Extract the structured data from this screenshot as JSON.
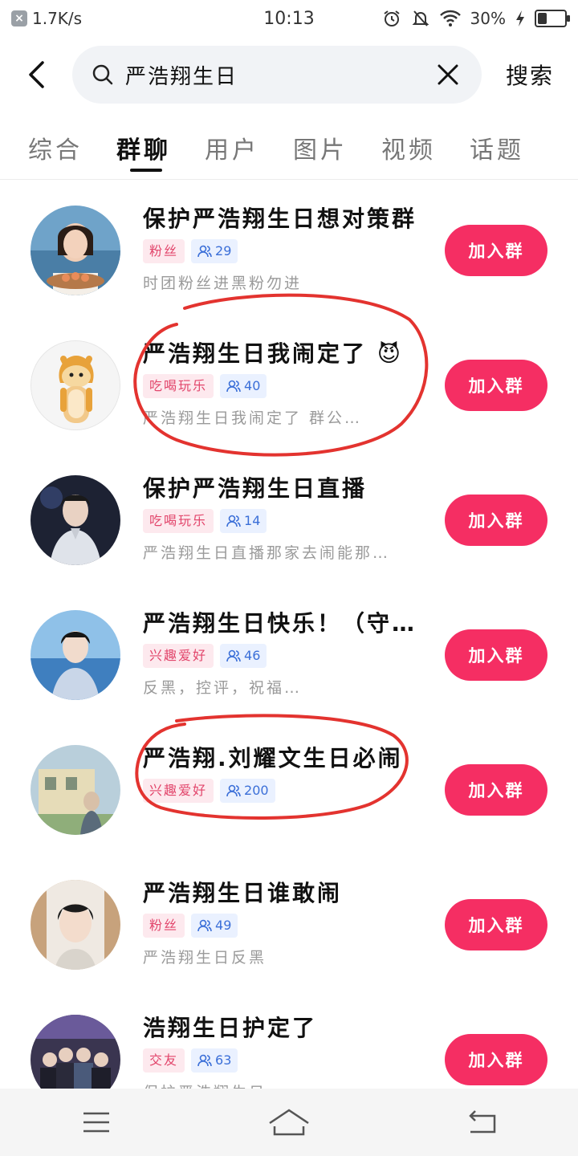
{
  "status_bar": {
    "speed": "1.7K/s",
    "time": "10:13",
    "battery": "30%",
    "battery_level": 0.3
  },
  "search": {
    "query": "严浩翔生日",
    "search_label": "搜索"
  },
  "tabs": [
    {
      "label": "综合",
      "active": false
    },
    {
      "label": "群聊",
      "active": true
    },
    {
      "label": "用户",
      "active": false
    },
    {
      "label": "图片",
      "active": false
    },
    {
      "label": "视频",
      "active": false
    },
    {
      "label": "话题",
      "active": false
    }
  ],
  "join_label": "加入群",
  "groups": [
    {
      "title": "保护严浩翔生日想对策群",
      "category": "粉丝",
      "members": "29",
      "desc": "时团粉丝进黑粉勿进"
    },
    {
      "title": "严浩翔生日我闹定了 😈",
      "category": "吃喝玩乐",
      "members": "40",
      "desc": "严浩翔生日我闹定了 群公…"
    },
    {
      "title": "保护严浩翔生日直播",
      "category": "吃喝玩乐",
      "members": "14",
      "desc": "严浩翔生日直播那家去闹能那…"
    },
    {
      "title": "严浩翔生日快乐！（守…",
      "category": "兴趣爱好",
      "members": "46",
      "desc": "反黑，控评，祝福…"
    },
    {
      "title": "严浩翔.刘耀文生日必闹",
      "category": "兴趣爱好",
      "members": "200",
      "desc": ""
    },
    {
      "title": "严浩翔生日谁敢闹",
      "category": "粉丝",
      "members": "49",
      "desc": "严浩翔生日反黑"
    },
    {
      "title": "浩翔生日护定了",
      "category": "交友",
      "members": "63",
      "desc": "保护严浩翔生日"
    }
  ],
  "colors": {
    "accent": "#f52e63",
    "category_bg": "#fde9ee",
    "category_text": "#e2456b",
    "count_bg": "#eaf1ff",
    "count_text": "#3b6fd8",
    "annotation": "#e3332f"
  }
}
